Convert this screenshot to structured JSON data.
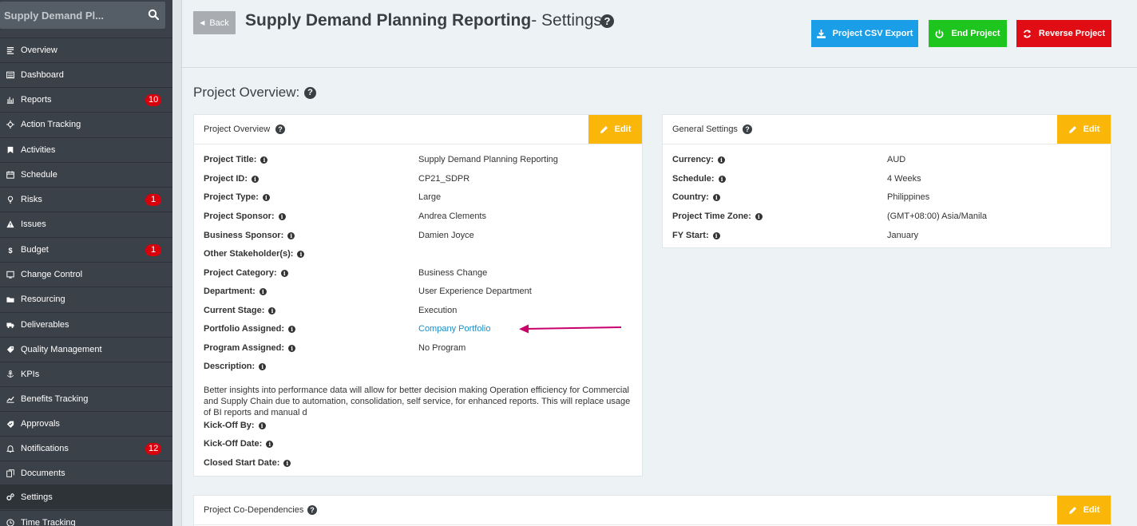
{
  "sidebar": {
    "search_text": "Supply Demand Pl...",
    "items": [
      {
        "label": "Overview",
        "badge": null
      },
      {
        "label": "Dashboard",
        "badge": null
      },
      {
        "label": "Reports",
        "badge": "10"
      },
      {
        "label": "Action Tracking",
        "badge": null
      },
      {
        "label": "Activities",
        "badge": null
      },
      {
        "label": "Schedule",
        "badge": null
      },
      {
        "label": "Risks",
        "badge": "1"
      },
      {
        "label": "Issues",
        "badge": null
      },
      {
        "label": "Budget",
        "badge": "1"
      },
      {
        "label": "Change Control",
        "badge": null
      },
      {
        "label": "Resourcing",
        "badge": null
      },
      {
        "label": "Deliverables",
        "badge": null
      },
      {
        "label": "Quality Management",
        "badge": null
      },
      {
        "label": "KPIs",
        "badge": null
      },
      {
        "label": "Benefits Tracking",
        "badge": null
      },
      {
        "label": "Approvals",
        "badge": null
      },
      {
        "label": "Notifications",
        "badge": "12"
      },
      {
        "label": "Documents",
        "badge": null
      },
      {
        "label": "Settings",
        "badge": null
      },
      {
        "label": "Time Tracking",
        "badge": null
      }
    ]
  },
  "header": {
    "back_label": "Back",
    "title": "Supply Demand Planning Reporting",
    "subtitle": "- Settings",
    "buttons": {
      "export": "Project CSV Export",
      "end": "End Project",
      "reverse": "Reverse Project"
    }
  },
  "section_title": "Project Overview:",
  "overview_panel": {
    "title": "Project Overview",
    "edit_label": "Edit",
    "rows": [
      {
        "label": "Project Title:",
        "value": "Supply Demand Planning Reporting"
      },
      {
        "label": "Project ID:",
        "value": "CP21_SDPR"
      },
      {
        "label": "Project Type:",
        "value": "Large"
      },
      {
        "label": "Project Sponsor:",
        "value": "Andrea Clements"
      },
      {
        "label": "Business Sponsor:",
        "value": "Damien Joyce"
      },
      {
        "label": "Other Stakeholder(s):",
        "value": ""
      },
      {
        "label": "Project Category:",
        "value": "Business Change"
      },
      {
        "label": "Department:",
        "value": "User Experience Department"
      },
      {
        "label": "Current Stage:",
        "value": "Execution"
      },
      {
        "label": "Portfolio Assigned:",
        "value": "Company Portfolio"
      },
      {
        "label": "Program Assigned:",
        "value": "No Program"
      },
      {
        "label": "Description:",
        "value": ""
      }
    ],
    "description": "Better insights into performance data will allow for better decision making Operation efficiency for Commercial and Supply Chain due to automation, consolidation, self service, for enhanced reports. This will replace usage of BI reports and manual d",
    "after_rows": [
      {
        "label": "Kick-Off By:"
      },
      {
        "label": "Kick-Off Date:"
      },
      {
        "label": "Closed Start Date:"
      }
    ]
  },
  "general_panel": {
    "title": "General Settings",
    "edit_label": "Edit",
    "rows": [
      {
        "label": "Currency:",
        "value": "AUD"
      },
      {
        "label": "Schedule:",
        "value": "4 Weeks"
      },
      {
        "label": "Country:",
        "value": "Philippines"
      },
      {
        "label": "Project Time Zone:",
        "value": "(GMT+08:00) Asia/Manila"
      },
      {
        "label": "FY Start:",
        "value": "January"
      }
    ]
  },
  "codeps_panel": {
    "title": "Project Co-Dependencies",
    "edit_label": "Edit"
  },
  "colors": {
    "sidebar_bg": "#3b4148",
    "badge_red": "#d9000d",
    "export_blue": "#1a9ee8",
    "end_green": "#1ec51e",
    "reverse_red": "#e00d14",
    "edit_yellow": "#fab70a",
    "link_blue": "#1a8ec7",
    "annotation_arrow": "#c8006b"
  }
}
